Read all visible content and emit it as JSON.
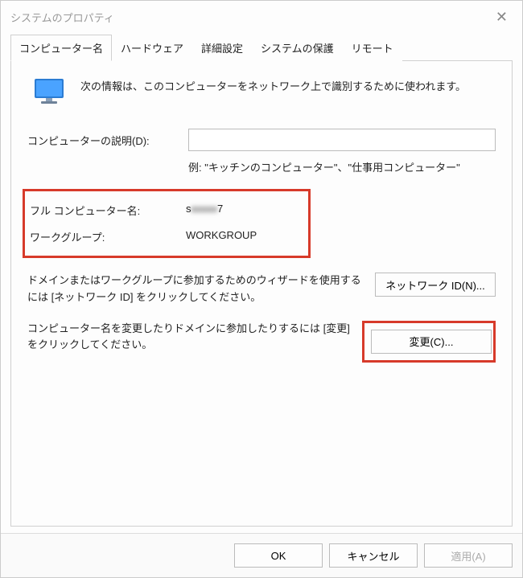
{
  "window": {
    "title": "システムのプロパティ"
  },
  "tabs": [
    {
      "label": "コンピューター名"
    },
    {
      "label": "ハードウェア"
    },
    {
      "label": "詳細設定"
    },
    {
      "label": "システムの保護"
    },
    {
      "label": "リモート"
    }
  ],
  "panel": {
    "intro": "次の情報は、このコンピューターをネットワーク上で識別するために使われます。",
    "descriptionLabel": "コンピューターの説明(D):",
    "descriptionValue": "",
    "exampleText": "例: \"キッチンのコンピューター\"、\"仕事用コンピューター\"",
    "fullNameLabel": "フル コンピューター名:",
    "fullNameValue": "sa        7",
    "workgroupLabel": "ワークグループ:",
    "workgroupValue": "WORKGROUP",
    "networkIdText": "ドメインまたはワークグループに参加するためのウィザードを使用するには [ネットワーク ID] をクリックしてください。",
    "networkIdBtn": "ネットワーク ID(N)...",
    "changeText": "コンピューター名を変更したりドメインに参加したりするには [変更] をクリックしてください。",
    "changeBtn": "変更(C)..."
  },
  "footer": {
    "ok": "OK",
    "cancel": "キャンセル",
    "apply": "適用(A)"
  }
}
